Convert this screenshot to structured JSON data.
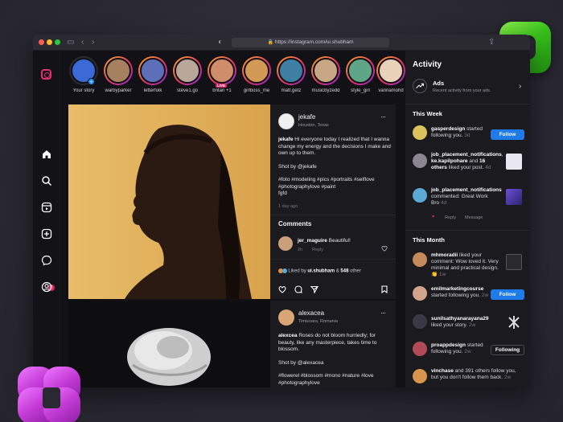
{
  "browser": {
    "url": "https://instagram.com/ui.shubham"
  },
  "stories": [
    {
      "name": "Your story",
      "color": "#3b6ad6",
      "own": true
    },
    {
      "name": "warbyparker",
      "color": "#a7805f"
    },
    {
      "name": "letterfolk",
      "color": "#5c6fb8"
    },
    {
      "name": "steve1.go",
      "color": "#b9a89a"
    },
    {
      "name": "britan +1",
      "color": "#d08d6b",
      "live": "LIVE"
    },
    {
      "name": "girlboss_me",
      "color": "#d39a55"
    },
    {
      "name": "matt.getz",
      "color": "#3f7fa3"
    },
    {
      "name": "musicbyzedd",
      "color": "#c8a884"
    },
    {
      "name": "style_girl",
      "color": "#5fa588"
    },
    {
      "name": "varinamohd",
      "color": "#e8d2b9"
    }
  ],
  "post1": {
    "username": "jekafe",
    "location": "Houston, Texas",
    "more": "···",
    "caption_user": "jekafe",
    "caption": "Hi everyone today I realized that I wanna change my energy and the decisions I make and own up to them.",
    "shot_by": "Shot by @jekafe",
    "tags": "#foto #modeling #pics #portraits #selflove #photographylove #paint",
    "tags2": "fgfd",
    "time": "1 day ago",
    "comments_heading": "Comments",
    "comment": {
      "user": "jer_maguire",
      "text": "Beautiful!",
      "age": "2h",
      "reply": "Reply"
    },
    "liked_prefix": "Liked by",
    "liked_user": "ui.shubham",
    "liked_mid": "&",
    "liked_count": "548",
    "liked_suffix": "other"
  },
  "post2": {
    "username": "alexacea",
    "location": "Timisoara, Romania",
    "more": "···",
    "caption_user": "alexcea",
    "caption": "Roses do not bloom hurriedly; for beauty, like any masterpiece, takes time to blossom.",
    "shot_by": "Shot by @alexacea",
    "tags": "#flowerel #blossom #mono #nature #love #photographylove"
  },
  "activity": {
    "title": "Activity",
    "ads_title": "Ads",
    "ads_sub": "Recent activity from your ads.",
    "this_week": "This Week",
    "this_month": "This Month",
    "items_week": [
      {
        "user": "gasperdesign",
        "text": "started following you.",
        "time": "3d",
        "button": "Follow",
        "avatar": "#d9c45b"
      },
      {
        "user": "job_placement_notifications",
        "mid": ",",
        "user2": "ke.kapilpohare",
        "text2": "and",
        "count": "16 others",
        "text": "liked your post.",
        "time": "4d",
        "avatar": "#8a8790",
        "thumb": "#e9e7ef"
      },
      {
        "user": "job_placement_notifications",
        "text": "commented: Great Work Bro",
        "time": "4d",
        "avatar": "#5aa9d6",
        "thumb": "#4b3f9c",
        "like": "♥",
        "reply": "Reply",
        "message": "Message"
      }
    ],
    "items_month": [
      {
        "user": "mhmoradii",
        "text": "liked your comment: Wow loved it. Very minimal and practical design.",
        "emoji": "👏",
        "time": "1w",
        "avatar": "#c78a5b",
        "thumb": "#2a2a2a"
      },
      {
        "user": "emilmarketingcourse",
        "text": "started following you.",
        "time": "2w",
        "button": "Follow",
        "avatar": "#d4a38c"
      },
      {
        "user": "sunilsathyanarayana29",
        "text": "liked your story.",
        "time": "2w",
        "avatar": "#3b3945",
        "thumb": "#dcdcdc"
      },
      {
        "user": "proappdesign",
        "text": "started following you.",
        "time": "2w",
        "button": "Following",
        "avatar": "#b04a57"
      },
      {
        "user": "vinchase",
        "text": "and 391 others follow you, but you don't follow them back.",
        "time": "2w",
        "avatar": "#d8934d"
      }
    ]
  },
  "colors": {
    "accent": "#1f7bea",
    "instagram_pink": "#e1306c",
    "window_bg": "#121115",
    "panel_bg": "#1b1a1f"
  }
}
